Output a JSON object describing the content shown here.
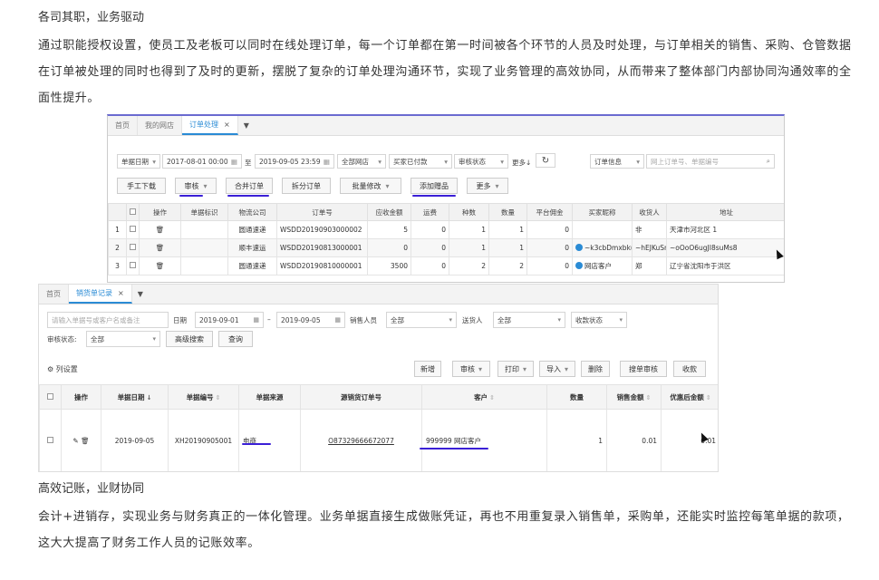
{
  "text": {
    "heading1": "各司其职，业务驱动",
    "paragraph1": "通过职能授权设置，使员工及老板可以同时在线处理订单，每一个订单都在第一时间被各个环节的人员及时处理，与订单相关的销售、采购、仓管数据在订单被处理的同时也得到了及时的更新，摆脱了复杂的订单处理沟通环节，实现了业务管理的高效协同，从而带来了整体部门内部协同沟通效率的全面性提升。",
    "heading2": "高效记账，业财协同",
    "paragraph2": "会计+进销存，实现业务与财务真正的一体化管理。业务单据直接生成做账凭证，再也不用重复录入销售单，采购单，还能实时监控每笔单据的款项，这大大提高了财务工作人员的记账效率。"
  },
  "order_screen": {
    "tabs": [
      "首页",
      "我的网店",
      "订单处理"
    ],
    "active_tab": "订单处理",
    "tab_close": "×",
    "tab_more": "▼",
    "filters": {
      "date_type": "单据日期",
      "date_from": "2017-08-01 00:00",
      "date_sep": "至",
      "date_to": "2019-09-05 23:59",
      "shop": "全部网店",
      "pay_status": "买家已付款",
      "audit_status": "审核状态",
      "more": "更多↓",
      "order_info": "订单信息",
      "search_placeholder": "网上订单号、单据编号"
    },
    "buttons": {
      "manual": "手工下载",
      "audit": "审核",
      "merge": "合并订单",
      "split": "拆分订单",
      "batch": "批量修改",
      "gift": "添加赠品",
      "more": "更多"
    },
    "columns": [
      "",
      "操作",
      "单据标识",
      "物流公司",
      "订单号",
      "应收金额",
      "运费",
      "种数",
      "数量",
      "平台佣金",
      "买家昵称",
      "收货人",
      "地址"
    ],
    "rows": [
      {
        "no": "1",
        "op": "🗑",
        "flag": "",
        "logistics": "圆通速递",
        "order": "WSDD20190903000002",
        "amount": "5",
        "freight": "0",
        "kinds": "1",
        "qty": "1",
        "commission": "0",
        "buyer": "",
        "receiver": "非",
        "address": "天津市河北区 1"
      },
      {
        "no": "2",
        "op": "🗑",
        "flag": "",
        "logistics": "顺丰速运",
        "order": "WSDD20190813000001",
        "amount": "0",
        "freight": "0",
        "kinds": "1",
        "qty": "1",
        "commission": "0",
        "buyer": "~k3cbDmxbk(",
        "receiver": "~hEJKuSnu",
        "address": "~oOoO6ugJI8suMs8"
      },
      {
        "no": "3",
        "op": "🗑",
        "flag": "",
        "logistics": "圆通速递",
        "order": "WSDD20190810000001",
        "amount": "3500",
        "freight": "0",
        "kinds": "2",
        "qty": "2",
        "commission": "0",
        "buyer": "网店客户",
        "receiver": "郑",
        "address": "辽宁省沈阳市于洪区"
      }
    ]
  },
  "sales_screen": {
    "tabs": [
      "首页",
      "销货单记录"
    ],
    "active_tab": "销货单记录",
    "tab_close": "×",
    "tab_more": "▼",
    "filters": {
      "search_placeholder": "请输入单据号或客户名或备注",
      "date_label": "日期",
      "date_from": "2019-09-01",
      "date_sep": "–",
      "date_to": "2019-09-05",
      "salesperson_label": "销售人员",
      "salesperson": "全部",
      "delivery_label": "送货人",
      "delivery": "全部",
      "payment_status": "收款状态",
      "audit_label": "审核状态:",
      "audit": "全部",
      "advanced": "高级搜索",
      "query": "查询"
    },
    "column_settings": "列设置",
    "toolbar": [
      "新增",
      "审核",
      "打印",
      "导入",
      "删除",
      "搜单审核",
      "收款"
    ],
    "columns": [
      "",
      "操作",
      "单据日期",
      "单据编号",
      "单据来源",
      "源销货订单号",
      "客户",
      "数量",
      "销售金额",
      "优惠后金额"
    ],
    "rows": [
      {
        "date": "2019-09-05",
        "number": "XH20190905001",
        "source": "电商",
        "source_order": "O87329666672077",
        "customer": "999999 网店客户",
        "qty": "1",
        "amount": "0.01",
        "discounted": "0.01"
      }
    ]
  }
}
